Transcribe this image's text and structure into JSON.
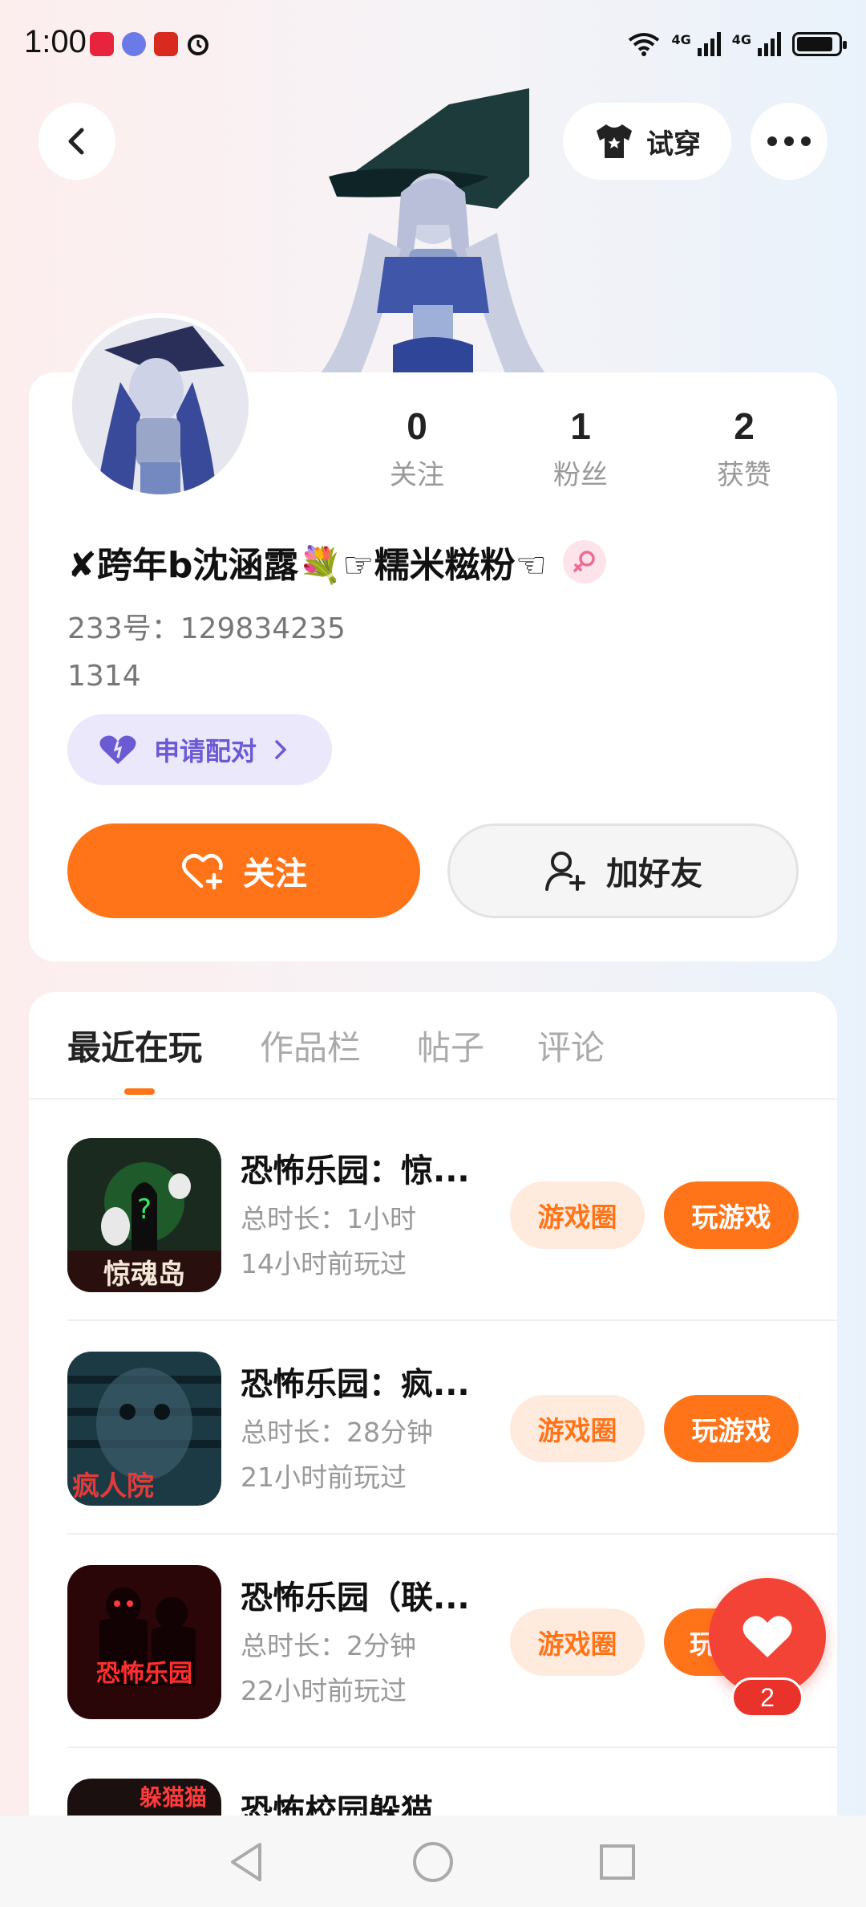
{
  "status_bar": {
    "time": "1:00",
    "network_1": "4G",
    "network_2": "4G"
  },
  "header": {
    "try_on_label": "试穿"
  },
  "profile": {
    "nickname": "✘跨年b沈涵露💐☞糯米糍粉☜",
    "id_line": "233号：129834235",
    "bio": "1314",
    "pair_label": "申请配对",
    "stats": [
      {
        "value": "0",
        "label": "关注"
      },
      {
        "value": "1",
        "label": "粉丝"
      },
      {
        "value": "2",
        "label": "获赞"
      }
    ],
    "follow_label": "关注",
    "add_friend_label": "加好友"
  },
  "tabs": [
    "最近在玩",
    "作品栏",
    "帖子",
    "评论"
  ],
  "games": [
    {
      "title": "恐怖乐园：惊...",
      "duration": "总时长：1小时",
      "last_played": "14小时前玩过",
      "thumb_text": "惊魂岛",
      "circle_label": "游戏圈",
      "play_label": "玩游戏"
    },
    {
      "title": "恐怖乐园：疯...",
      "duration": "总时长：28分钟",
      "last_played": "21小时前玩过",
      "thumb_text": "疯人院",
      "circle_label": "游戏圈",
      "play_label": "玩游戏"
    },
    {
      "title": "恐怖乐园（联...",
      "duration": "总时长：2分钟",
      "last_played": "22小时前玩过",
      "thumb_text": "恐怖乐园",
      "circle_label": "游戏圈",
      "play_label": "玩"
    },
    {
      "title": "恐怖校园躲猫",
      "thumb_text": "躲猫猫"
    }
  ],
  "floating_like": {
    "count": "2"
  },
  "colors": {
    "accent": "#ff7418",
    "accent_light": "#ffebde",
    "like_red": "#f24336",
    "pair_purple": "#6b5bd3"
  }
}
